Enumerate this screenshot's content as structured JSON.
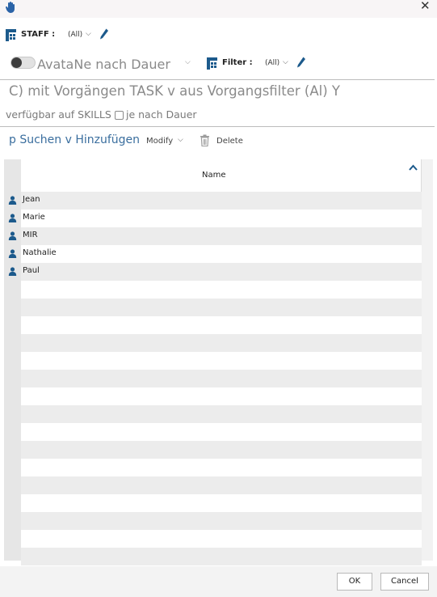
{
  "filters": {
    "staff_label": "STAFF :",
    "staff_value": "(All)",
    "avail_label": "AvataNe nach Dauer",
    "filter_label": "Filter :",
    "filter_value": "(All)"
  },
  "task_line": "C) mit Vorgängen TASK v aus Vorgangsfilter (Al) Y",
  "skills_line": {
    "label": "verfügbar auf SKILLS",
    "checkbox_label": "je nach Dauer"
  },
  "toolbar": {
    "search_label": "p Suchen v Hinzufügen",
    "modify_label": "Modify",
    "delete_label": "Delete"
  },
  "grid": {
    "column_header": "Name",
    "rows": [
      "Jean",
      "Marie",
      "MIR",
      "Nathalie",
      "Paul"
    ]
  },
  "footer": {
    "ok_label": "OK",
    "cancel_label": "Cancel"
  },
  "colors": {
    "accent_blue": "#1c5a8c",
    "link_blue": "#3a6e9e"
  }
}
